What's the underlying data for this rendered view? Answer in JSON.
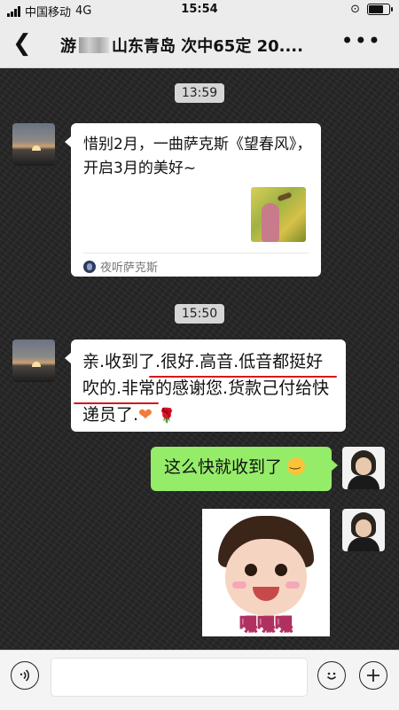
{
  "status_bar": {
    "carrier": "中国移动",
    "network": "4G",
    "time": "15:54",
    "battery_level": 0.8
  },
  "nav": {
    "back_icon": "chevron-left-icon",
    "title_prefix": "游",
    "title_rest": "山东青岛 次中65定 20....",
    "more_icon": "more-icon"
  },
  "messages": {
    "time1": "13:59",
    "card": {
      "title": "惜别2月，一曲萨克斯《望春风》，开启3月的美好~",
      "source": "夜听萨克斯"
    },
    "time2": "15:50",
    "msg2": {
      "text": "亲.收到了.很好.高音.低音都挺好吹的.非常的感谢您.货款己付给快递员了.",
      "heart": "❤",
      "rose": "🌹"
    },
    "msg3": {
      "text": "这么快就收到了"
    },
    "sticker": {
      "text": "嘿嘿嘿"
    }
  },
  "input_bar": {
    "voice_icon": "voice-icon",
    "emoji_icon": "emoji-icon",
    "add_icon": "add-icon"
  }
}
